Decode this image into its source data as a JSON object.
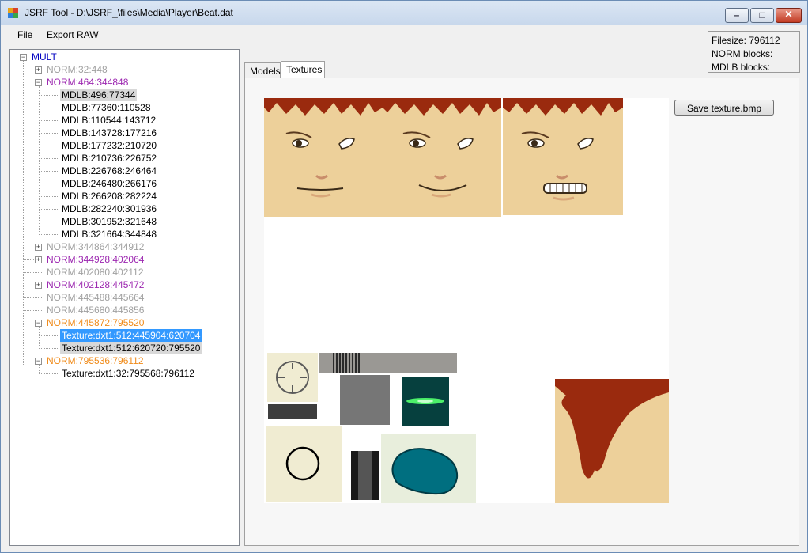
{
  "window": {
    "title": "JSRF Tool - D:\\JSRF_\\files\\Media\\Player\\Beat.dat"
  },
  "menu": [
    "File",
    "Export RAW"
  ],
  "info": {
    "filesize": "Filesize: 796112",
    "norm_blocks": "NORM blocks:",
    "mdlb_blocks": "MDLB blocks:"
  },
  "tree": {
    "root": "MULT",
    "nodes": [
      "NORM:32:448",
      "NORM:464:344848",
      "MDLB:496:77344",
      "MDLB:77360:110528",
      "MDLB:110544:143712",
      "MDLB:143728:177216",
      "MDLB:177232:210720",
      "MDLB:210736:226752",
      "MDLB:226768:246464",
      "MDLB:246480:266176",
      "MDLB:266208:282224",
      "MDLB:282240:301936",
      "MDLB:301952:321648",
      "MDLB:321664:344848",
      "NORM:344864:344912",
      "NORM:344928:402064",
      "NORM:402080:402112",
      "NORM:402128:445472",
      "NORM:445488:445664",
      "NORM:445680:445856",
      "NORM:445872:795520",
      "Texture:dxt1:512:445904:620704",
      "Texture:dxt1:512:620720:795520",
      "NORM:795536:796112",
      "Texture:dxt1:32:795568:796112"
    ]
  },
  "tabs": [
    "Models",
    "Textures"
  ],
  "save_button": "Save texture.bmp",
  "colors": {
    "skin": "#edd09a",
    "hair": "#9a2a0e",
    "teal": "#006f80",
    "selection": "#3399ff"
  },
  "icons": {
    "app": "app-icon",
    "minimize": "minimize-icon",
    "maximize": "maximize-icon",
    "close": "close-icon"
  }
}
